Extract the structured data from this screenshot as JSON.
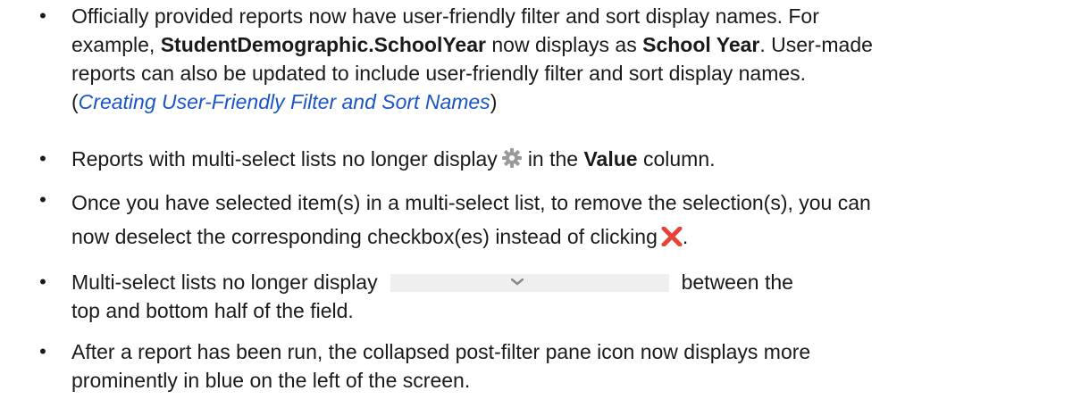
{
  "items": [
    {
      "bullet": "•",
      "line1": "Officially provided reports now have user-friendly filter and sort display names. For",
      "line2_a": "example, ",
      "line2_b1": "StudentDemographic.SchoolYear",
      "line2_c": " now displays as ",
      "line2_b2": "School Year",
      "line2_d": ". User-made",
      "line3": "reports can also be updated to include user-friendly filter and sort display names.",
      "line4_open": "(",
      "line4_link": "Creating User-Friendly Filter and Sort Names",
      "line4_close": ")"
    },
    {
      "bullet": "•",
      "a": "Reports with multi-select lists no longer display",
      "icon": "gear-icon",
      "b": "in the ",
      "bold": "Value",
      "c": " column."
    },
    {
      "bullet": "•",
      "line1": "Once you have selected item(s) in a multi-select list, to remove the selection(s), you can",
      "line2": "now deselect the corresponding checkbox(es) instead of clicking",
      "icon": "close-x-icon",
      "line2_end": "."
    },
    {
      "bullet": "•",
      "a": "Multi-select lists no longer display",
      "icon": "separator-bar-chevron-icon",
      "b": "between the",
      "line2": "top and bottom half of the field."
    },
    {
      "bullet": "•",
      "line1": "After a report has been run, the collapsed post-filter pane icon now displays more",
      "line2": "prominently in blue on the left of the screen."
    }
  ],
  "colors": {
    "link": "#1a55c8",
    "close_icon": "#e8423a",
    "gear_icon": "#9a9a9a",
    "separator_bar": "#efefef"
  }
}
